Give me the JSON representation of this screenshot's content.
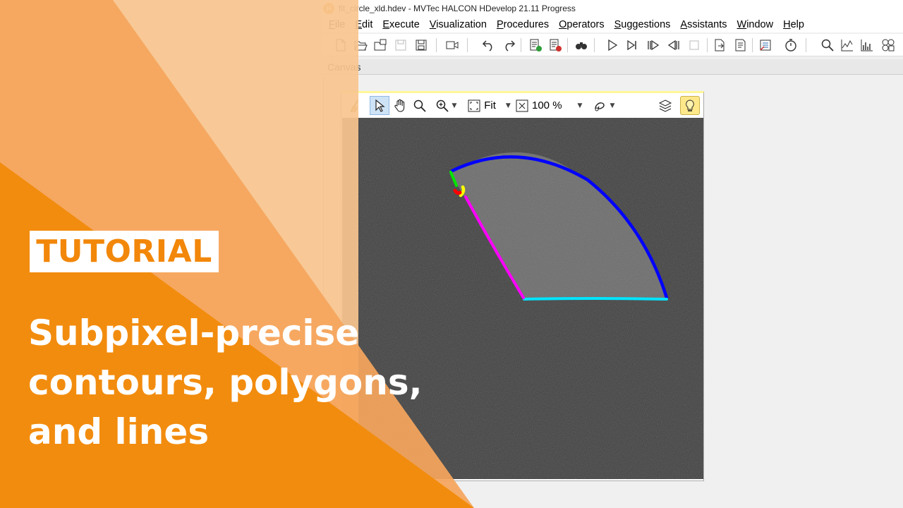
{
  "window": {
    "title": "fit_circle_xld.hdev - MVTec HALCON HDevelop 21.11 Progress",
    "logo_text": "H"
  },
  "menu": [
    "File",
    "Edit",
    "Execute",
    "Visualization",
    "Procedures",
    "Operators",
    "Suggestions",
    "Assistants",
    "Window",
    "Help"
  ],
  "toolbar_icons": [
    "new-file-icon",
    "open-file-icon",
    "open-example-icon",
    "save-disabled-icon",
    "save-all-icon",
    "record-video-icon",
    "undo-icon",
    "redo-icon",
    "activate-line-icon",
    "deactivate-line-icon",
    "binoculars-icon",
    "run-icon",
    "step-over-icon",
    "step-into-icon",
    "step-out-icon",
    "stop-icon",
    "export-icon",
    "script-icon",
    "variables-icon",
    "stopwatch-icon",
    "zoom-icon",
    "line-profile-icon",
    "histogram-icon",
    "feature-inspection-icon"
  ],
  "canvas": {
    "panel_title": "Canvas",
    "fit_label": "Fit",
    "zoom_label": "100 %"
  },
  "overlay": {
    "badge": "TUTORIAL",
    "headline": [
      "Subpixel-precise",
      "contours, polygons,",
      "and lines"
    ]
  },
  "colors": {
    "orange_strong": "#f28c0e",
    "orange_mid": "#f5a65c",
    "orange_light": "#f9c58e",
    "contour_blue": "#0000ff",
    "contour_cyan": "#00e5ff",
    "contour_magenta": "#ff00ff",
    "contour_green": "#00e600",
    "contour_yellow": "#ffff00",
    "contour_red": "#ff0000"
  }
}
